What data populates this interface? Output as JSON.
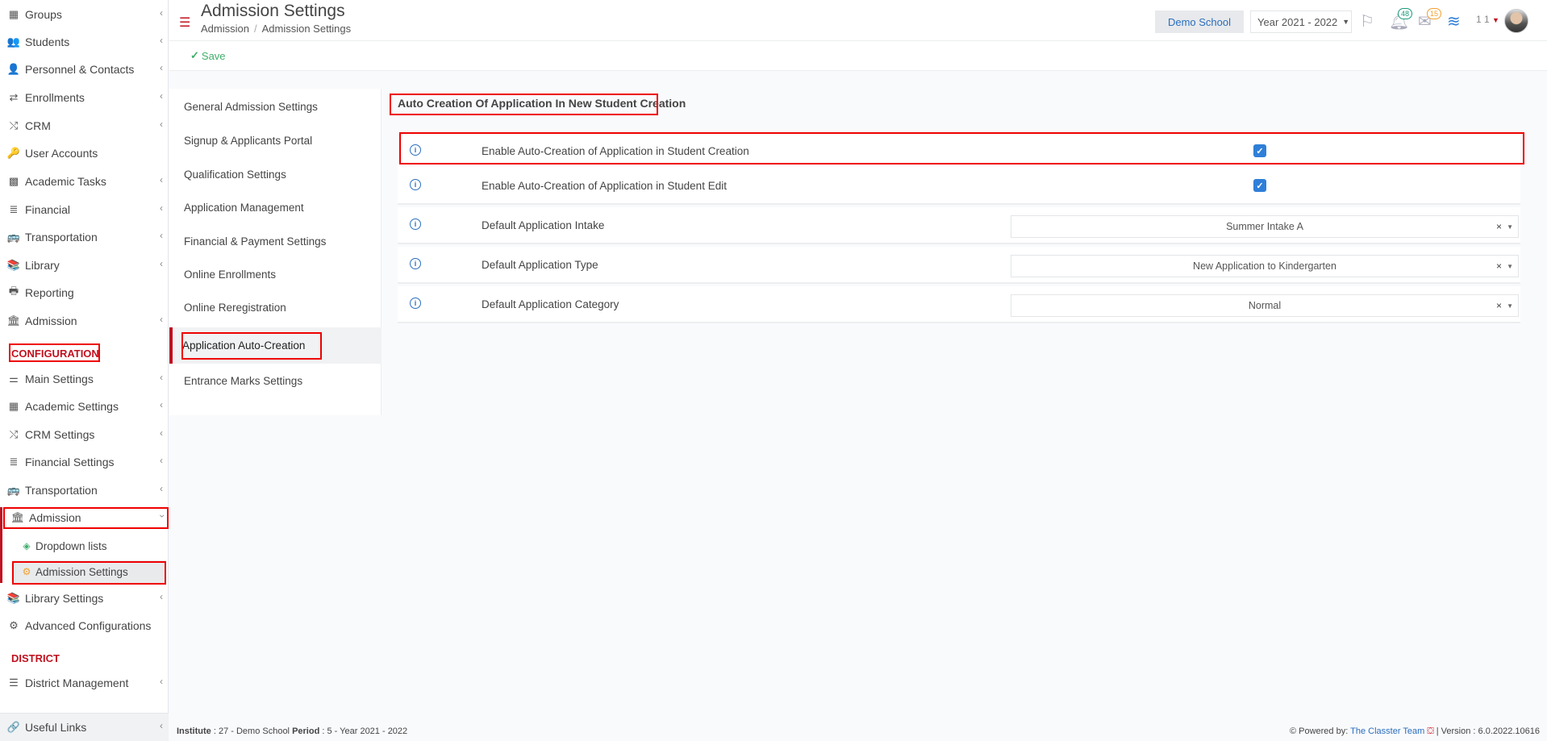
{
  "sidebar": {
    "items": [
      {
        "label": "Groups",
        "icon": "groups-icon"
      },
      {
        "label": "Students",
        "icon": "students-icon"
      },
      {
        "label": "Personnel & Contacts",
        "icon": "personnel-icon"
      },
      {
        "label": "Enrollments",
        "icon": "enrollments-icon"
      },
      {
        "label": "CRM",
        "icon": "crm-icon"
      },
      {
        "label": "User Accounts",
        "icon": "key-icon"
      },
      {
        "label": "Academic Tasks",
        "icon": "grid-icon"
      },
      {
        "label": "Financial",
        "icon": "coins-icon"
      },
      {
        "label": "Transportation",
        "icon": "bus-icon"
      },
      {
        "label": "Library",
        "icon": "books-icon"
      },
      {
        "label": "Reporting",
        "icon": "printer-icon"
      },
      {
        "label": "Admission",
        "icon": "bank-icon"
      }
    ],
    "config_section": "CONFIGURATION",
    "config_items": [
      {
        "label": "Main Settings",
        "icon": "sliders-icon"
      },
      {
        "label": "Academic Settings",
        "icon": "groups-icon"
      },
      {
        "label": "CRM Settings",
        "icon": "crm-icon"
      },
      {
        "label": "Financial Settings",
        "icon": "coins-icon"
      },
      {
        "label": "Transportation",
        "icon": "bus-icon"
      },
      {
        "label": "Admission",
        "icon": "bank-icon"
      }
    ],
    "admission_sub": [
      {
        "label": "Dropdown lists",
        "icon": "layers-icon"
      },
      {
        "label": "Admission Settings",
        "icon": "gear-icon"
      }
    ],
    "after_items": [
      {
        "label": "Library Settings",
        "icon": "books-icon"
      },
      {
        "label": "Advanced Configurations",
        "icon": "gears-icon"
      }
    ],
    "district_section": "DISTRICT",
    "district_items": [
      {
        "label": "District Management",
        "icon": "list-icon"
      }
    ],
    "footer_label": "Useful Links"
  },
  "header": {
    "title": "Admission Settings",
    "breadcrumb": [
      "Admission",
      "Admission Settings"
    ],
    "school": "Demo School",
    "year": "Year 2021 - 2022",
    "notifications_count": "48",
    "messages_count": "15",
    "user_meta": "1 1"
  },
  "toolbar": {
    "save_label": "Save"
  },
  "settings_nav": [
    "General Admission Settings",
    "Signup & Applicants Portal",
    "Qualification Settings",
    "Application Management",
    "Financial & Payment Settings",
    "Online Enrollments",
    "Online Reregistration",
    "Application Auto-Creation",
    "Entrance Marks Settings"
  ],
  "main": {
    "section_title": "Auto Creation Of Application In New Student Creation",
    "rows": [
      {
        "label": "Enable Auto-Creation of Application in Student Creation",
        "type": "checkbox",
        "checked": true
      },
      {
        "label": "Enable Auto-Creation of Application in Student Edit",
        "type": "checkbox",
        "checked": true
      },
      {
        "label": "Default Application Intake",
        "type": "select",
        "value": "Summer Intake A"
      },
      {
        "label": "Default Application Type",
        "type": "select",
        "value": "New Application to Kindergarten"
      },
      {
        "label": "Default Application Category",
        "type": "select",
        "value": "Normal"
      }
    ]
  },
  "footer": {
    "institute_label": "Institute",
    "institute_value": ": 27 - Demo School",
    "period_label": "Period",
    "period_value": ": 5 - Year 2021 - 2022",
    "powered_by": "Powered by:",
    "team": "The Classter Team",
    "version": "| Version : 6.0.2022.10616"
  },
  "colors": {
    "brand_red": "#c0111f",
    "link_blue": "#2a6ebd",
    "save_green": "#3fae6b",
    "highlight_box": "#ee0000"
  }
}
